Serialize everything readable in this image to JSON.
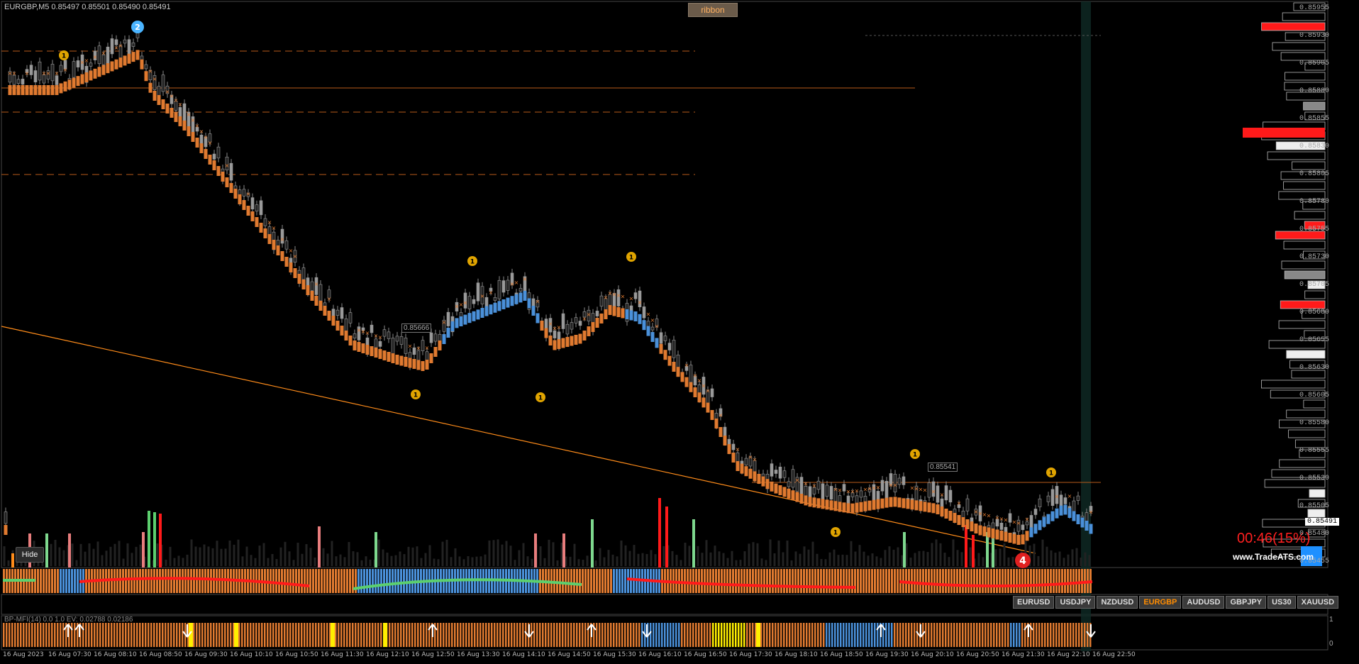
{
  "header": {
    "symbol_info": "EURGBP,M5  0.85497 0.85501 0.85490 0.85491",
    "ribbon_button": "ribbon"
  },
  "price_axis": {
    "labels": [
      "0.85955",
      "0.85930",
      "0.85905",
      "0.85880",
      "0.85855",
      "0.85830",
      "0.85805",
      "0.85780",
      "0.85755",
      "0.85730",
      "0.85705",
      "0.85680",
      "0.85655",
      "0.85630",
      "0.85605",
      "0.85580",
      "0.85555",
      "0.85530",
      "0.85505",
      "0.85480",
      "0.85455"
    ],
    "current_price": "0.85491"
  },
  "chart_labels": {
    "level_1": "0.85666",
    "level_2": "0.85541"
  },
  "hide_button": "Hide",
  "countdown": "00:46(15%)",
  "website": "www.TradeATS.com",
  "symbols": [
    {
      "label": "EURUSD",
      "active": false
    },
    {
      "label": "USDJPY",
      "active": false
    },
    {
      "label": "NZDUSD",
      "active": false
    },
    {
      "label": "EURGBP",
      "active": true
    },
    {
      "label": "AUDUSD",
      "active": false
    },
    {
      "label": "GBPJPY",
      "active": false
    },
    {
      "label": "US30",
      "active": false
    },
    {
      "label": "XAUUSD",
      "active": false
    }
  ],
  "indicator": {
    "label": "BP-MFI(14) 0.0 1.0  EV: 0.02788  0.02186",
    "scale_top": "1",
    "scale_bottom": "0"
  },
  "time_axis": [
    "16 Aug 2023",
    "16 Aug 07:30",
    "16 Aug 08:10",
    "16 Aug 08:50",
    "16 Aug 09:30",
    "16 Aug 10:10",
    "16 Aug 10:50",
    "16 Aug 11:30",
    "16 Aug 12:10",
    "16 Aug 12:50",
    "16 Aug 13:30",
    "16 Aug 14:10",
    "16 Aug 14:50",
    "16 Aug 15:30",
    "16 Aug 16:10",
    "16 Aug 16:50",
    "16 Aug 17:30",
    "16 Aug 18:10",
    "16 Aug 18:50",
    "16 Aug 19:30",
    "16 Aug 20:10",
    "16 Aug 20:50",
    "16 Aug 21:30",
    "16 Aug 22:10",
    "16 Aug 22:50"
  ],
  "markers": {
    "signal_number_left": "2",
    "signal_number_right": "4",
    "badge": "1"
  },
  "colors": {
    "bear": "#e07a30",
    "bull": "#4a90d9",
    "grid_dash": "#b85a1a",
    "trendline": "#ff8c1a",
    "volume_red": "#ff1a1a",
    "volume_green": "#5ccf6e"
  }
}
